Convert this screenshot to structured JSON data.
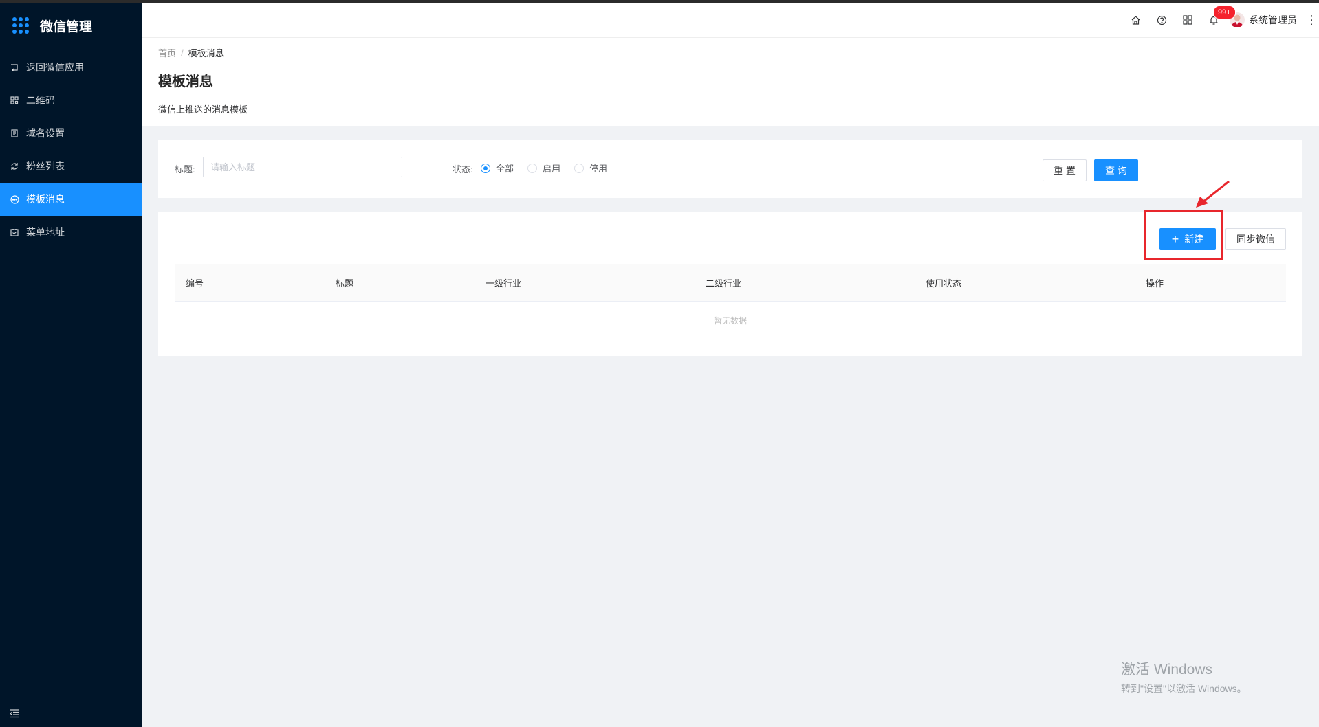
{
  "app": {
    "title": "微信管理"
  },
  "sidebar": {
    "items": [
      {
        "label": "返回微信应用",
        "icon": "return-icon"
      },
      {
        "label": "二维码",
        "icon": "qrcode-icon"
      },
      {
        "label": "域名设置",
        "icon": "document-icon"
      },
      {
        "label": "粉丝列表",
        "icon": "refresh-icon"
      },
      {
        "label": "模板消息",
        "icon": "message-icon",
        "active": true
      },
      {
        "label": "菜单地址",
        "icon": "calendar-check-icon"
      }
    ]
  },
  "header": {
    "notification_badge": "99+",
    "username": "系统管理员"
  },
  "page": {
    "breadcrumb": [
      "首页",
      "模板消息"
    ],
    "title": "模板消息",
    "description": "微信上推送的消息模板"
  },
  "search": {
    "title_label": "标题:",
    "title_placeholder": "请输入标题",
    "status_label": "状态:",
    "status_options": [
      "全部",
      "启用",
      "停用"
    ],
    "status_selected": "全部",
    "reset_label": "重 置",
    "query_label": "查 询"
  },
  "toolbar": {
    "new_label": "新建",
    "sync_label": "同步微信"
  },
  "table": {
    "columns": [
      "编号",
      "标题",
      "一级行业",
      "二级行业",
      "使用状态",
      "操作"
    ],
    "rows": [],
    "empty_text": "暂无数据"
  },
  "watermark": {
    "title": "激活 Windows",
    "subtitle": "转到\"设置\"以激活 Windows。"
  },
  "colors": {
    "sidebar_bg": "#001529",
    "primary": "#1890ff",
    "annotation_red": "#e8262c",
    "badge": "#f5222d"
  }
}
